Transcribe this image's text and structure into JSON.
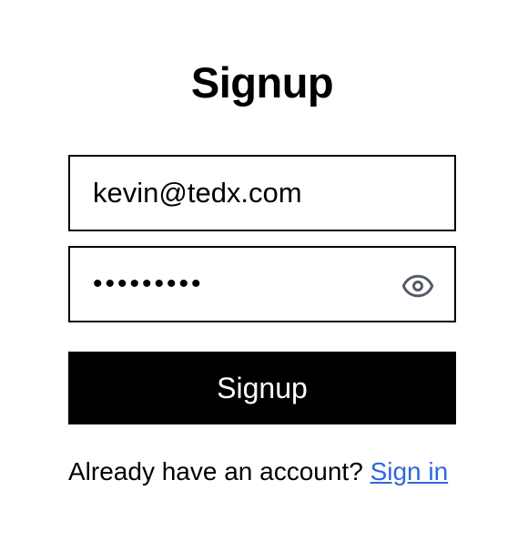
{
  "page": {
    "title": "Signup"
  },
  "form": {
    "email": {
      "value": "kevin@tedx.com"
    },
    "password": {
      "value": "12345678!",
      "toggle_icon": "eye-icon"
    },
    "submit_label": "Signup"
  },
  "footer": {
    "prompt": "Already have an account?",
    "link_label": "Sign in"
  },
  "colors": {
    "button_background": "#000000",
    "button_text": "#ffffff",
    "link": "#2f67dc",
    "input_border": "#000000",
    "icon": "#555b66"
  }
}
